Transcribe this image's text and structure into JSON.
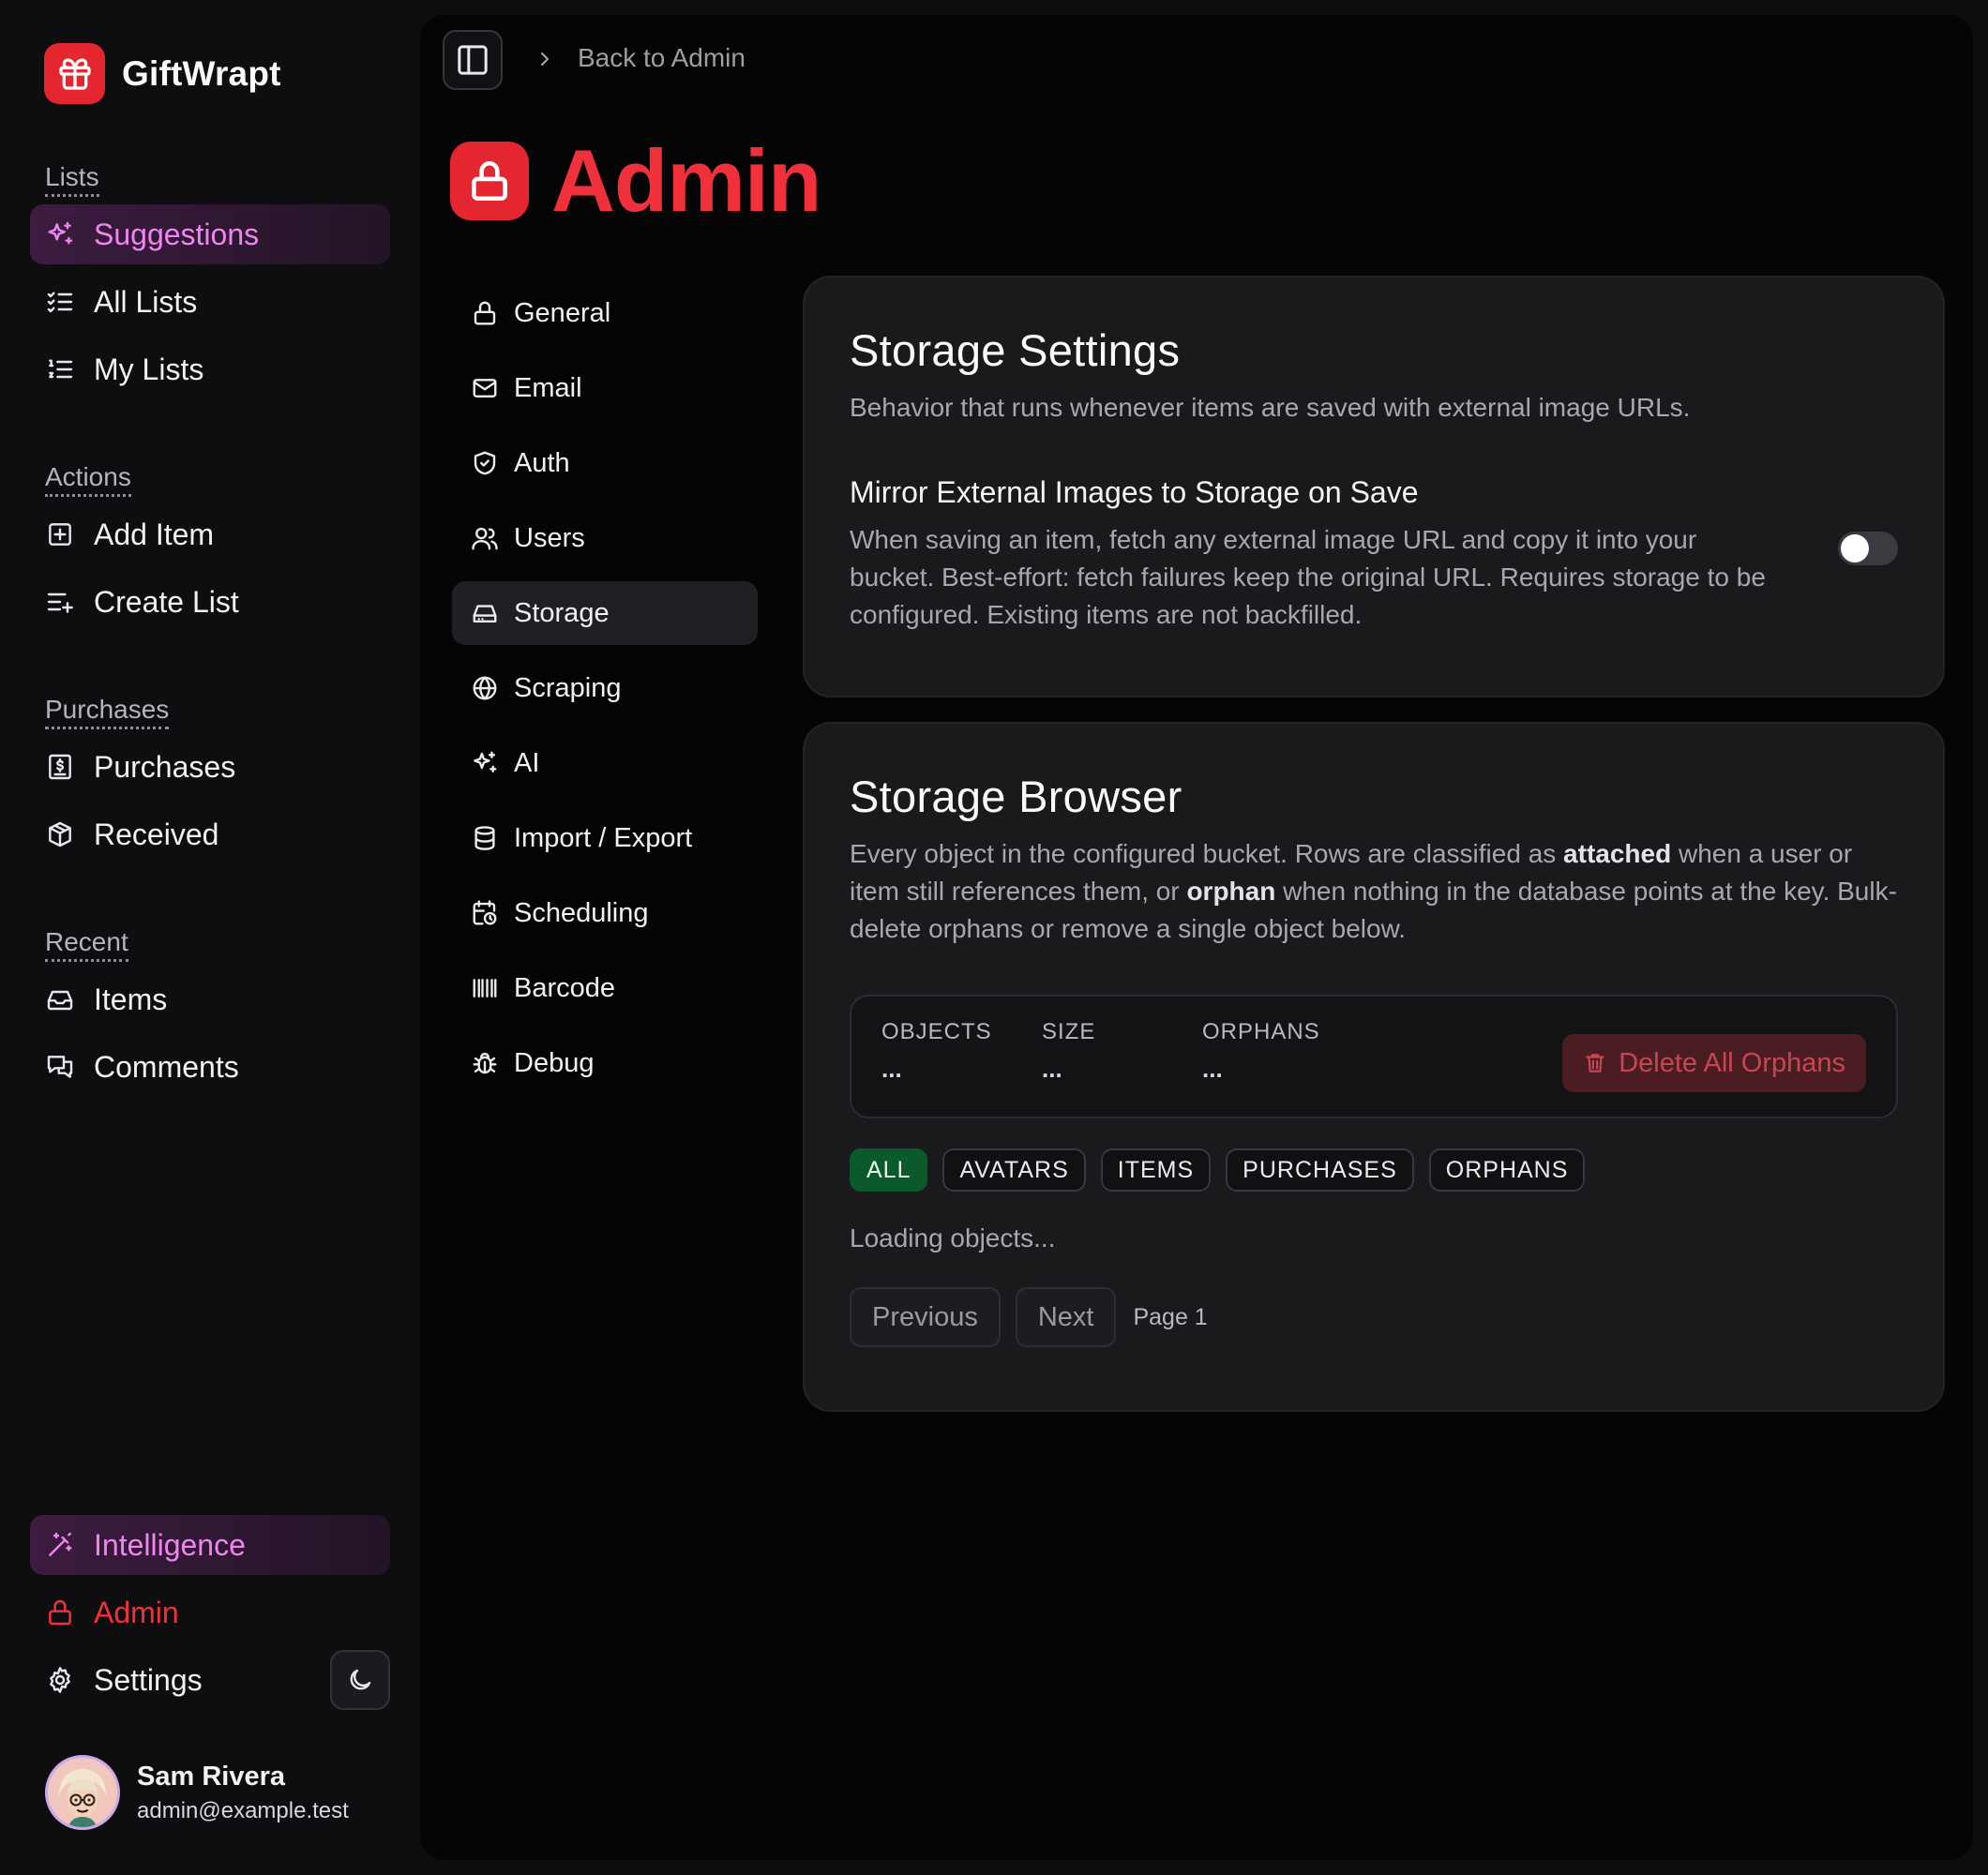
{
  "brand": {
    "name": "GiftWrapt",
    "accent": "#e3262f"
  },
  "sidebar": {
    "groups": [
      {
        "label": "Lists",
        "items": [
          {
            "label": "Suggestions",
            "icon": "sparkles-icon",
            "active": true
          },
          {
            "label": "All Lists",
            "icon": "list-checks-icon"
          },
          {
            "label": "My Lists",
            "icon": "list-ordered-icon"
          }
        ]
      },
      {
        "label": "Actions",
        "items": [
          {
            "label": "Add Item",
            "icon": "square-plus-icon"
          },
          {
            "label": "Create List",
            "icon": "list-plus-icon"
          }
        ]
      },
      {
        "label": "Purchases",
        "items": [
          {
            "label": "Purchases",
            "icon": "receipt-icon"
          },
          {
            "label": "Received",
            "icon": "package-icon"
          }
        ]
      },
      {
        "label": "Recent",
        "items": [
          {
            "label": "Items",
            "icon": "inbox-icon"
          },
          {
            "label": "Comments",
            "icon": "messages-icon"
          }
        ]
      }
    ],
    "bottom": {
      "intelligence": "Intelligence",
      "admin": "Admin",
      "settings": "Settings"
    },
    "user": {
      "name": "Sam Rivera",
      "email": "admin@example.test"
    }
  },
  "header": {
    "breadcrumb": "Back to Admin",
    "title": "Admin"
  },
  "subnav": [
    {
      "label": "General",
      "icon": "lock-icon"
    },
    {
      "label": "Email",
      "icon": "mail-icon"
    },
    {
      "label": "Auth",
      "icon": "shield-icon"
    },
    {
      "label": "Users",
      "icon": "users-icon"
    },
    {
      "label": "Storage",
      "icon": "hard-drive-icon",
      "active": true
    },
    {
      "label": "Scraping",
      "icon": "globe-icon"
    },
    {
      "label": "AI",
      "icon": "sparkles-icon"
    },
    {
      "label": "Import / Export",
      "icon": "database-icon"
    },
    {
      "label": "Scheduling",
      "icon": "calendar-clock-icon"
    },
    {
      "label": "Barcode",
      "icon": "barcode-icon"
    },
    {
      "label": "Debug",
      "icon": "bug-icon"
    }
  ],
  "storage_settings": {
    "title": "Storage Settings",
    "description": "Behavior that runs whenever items are saved with external image URLs.",
    "mirror": {
      "title": "Mirror External Images to Storage on Save",
      "text": "When saving an item, fetch any external image URL and copy it into your bucket. Best-effort: fetch failures keep the original URL. Requires storage to be configured. Existing items are not backfilled.",
      "enabled": false
    }
  },
  "storage_browser": {
    "title": "Storage Browser",
    "desc_1": "Every object in the configured bucket. Rows are classified as ",
    "desc_attached": "attached",
    "desc_2": " when a user or item still references them, or ",
    "desc_orphan": "orphan",
    "desc_3": " when nothing in the database points at the key. Bulk-delete orphans or remove a single object below.",
    "stats": [
      {
        "label": "OBJECTS",
        "value": "..."
      },
      {
        "label": "SIZE",
        "value": "..."
      },
      {
        "label": "ORPHANS",
        "value": "..."
      }
    ],
    "delete_label": "Delete All Orphans",
    "filters": [
      "ALL",
      "AVATARS",
      "ITEMS",
      "PURCHASES",
      "ORPHANS"
    ],
    "active_filter": "ALL",
    "loading": "Loading objects...",
    "previous": "Previous",
    "next": "Next",
    "page_label": "Page 1"
  }
}
